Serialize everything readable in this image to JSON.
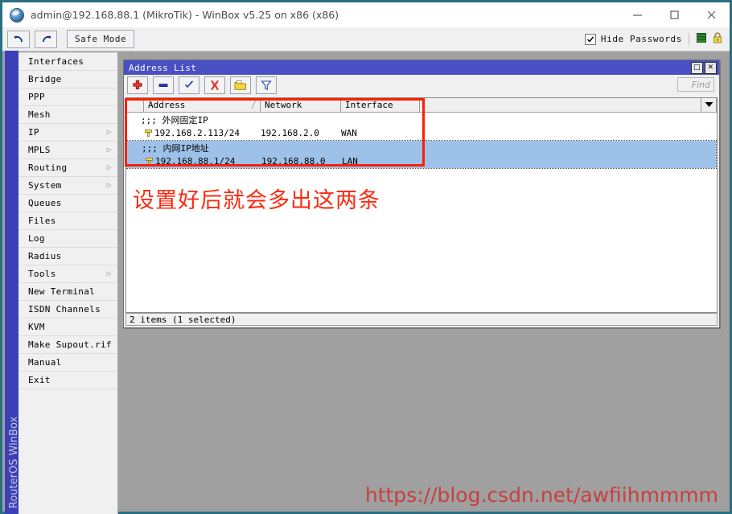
{
  "window": {
    "title": "admin@192.168.88.1 (MikroTik) - WinBox v5.25 on x86 (x86)",
    "icon": "globe-icon",
    "minimize": "—",
    "maximize": "□",
    "close": "✕"
  },
  "toolbar": {
    "undo_icon": "undo-arrow-icon",
    "redo_icon": "redo-arrow-icon",
    "safe_mode_label": "Safe Mode",
    "hide_passwords_label": "Hide Passwords",
    "hide_passwords_checked": true,
    "session_icon": "green-bars-icon",
    "lock_icon": "padlock-icon"
  },
  "sidebar": {
    "vertical_label": "RouterOS WinBox",
    "accent_color": "#3b3fb8",
    "items": [
      {
        "label": "Interfaces",
        "submenu": false
      },
      {
        "label": "Bridge",
        "submenu": false
      },
      {
        "label": "PPP",
        "submenu": false
      },
      {
        "label": "Mesh",
        "submenu": false
      },
      {
        "label": "IP",
        "submenu": true
      },
      {
        "label": "MPLS",
        "submenu": true
      },
      {
        "label": "Routing",
        "submenu": true
      },
      {
        "label": "System",
        "submenu": true
      },
      {
        "label": "Queues",
        "submenu": false
      },
      {
        "label": "Files",
        "submenu": false
      },
      {
        "label": "Log",
        "submenu": false
      },
      {
        "label": "Radius",
        "submenu": false
      },
      {
        "label": "Tools",
        "submenu": true
      },
      {
        "label": "New Terminal",
        "submenu": false
      },
      {
        "label": "ISDN Channels",
        "submenu": false
      },
      {
        "label": "KVM",
        "submenu": false
      },
      {
        "label": "Make Supout.rif",
        "submenu": false
      },
      {
        "label": "Manual",
        "submenu": false
      },
      {
        "label": "Exit",
        "submenu": false
      }
    ]
  },
  "address_list": {
    "title": "Address List",
    "title_bar_color": "#4b4fc4",
    "restore_label": "□",
    "close_label": "✕",
    "buttons": [
      {
        "name": "add-button",
        "icon": "plus-icon"
      },
      {
        "name": "remove-button",
        "icon": "minus-icon"
      },
      {
        "name": "enable-button",
        "icon": "check-icon"
      },
      {
        "name": "disable-button",
        "icon": "cross-icon"
      },
      {
        "name": "comment-button",
        "icon": "comment-folder-icon"
      },
      {
        "name": "filter-button",
        "icon": "funnel-icon"
      }
    ],
    "find_placeholder": "Find",
    "columns": [
      "Address",
      "Network",
      "Interface"
    ],
    "sort_indicator": "╱",
    "rows": [
      {
        "type": "comment",
        "text": ";;;  外网固定IP",
        "selected": false
      },
      {
        "type": "entry",
        "address": "192.168.2.113/24",
        "network": "192.168.2.0",
        "interface": "WAN",
        "selected": false
      },
      {
        "type": "comment",
        "text": ";;;  内网IP地址",
        "selected": true
      },
      {
        "type": "entry",
        "address": "192.168.88.1/24",
        "network": "192.168.88.0",
        "interface": "LAN",
        "selected": true
      }
    ],
    "status": "2 items (1 selected)"
  },
  "annotations": {
    "highlight_color": "#fe1f00",
    "note_text": "设置好后就会多出这两条",
    "watermark": "https://blog.csdn.net/awfiihmmmm",
    "watermark_color": "#c7403f"
  }
}
